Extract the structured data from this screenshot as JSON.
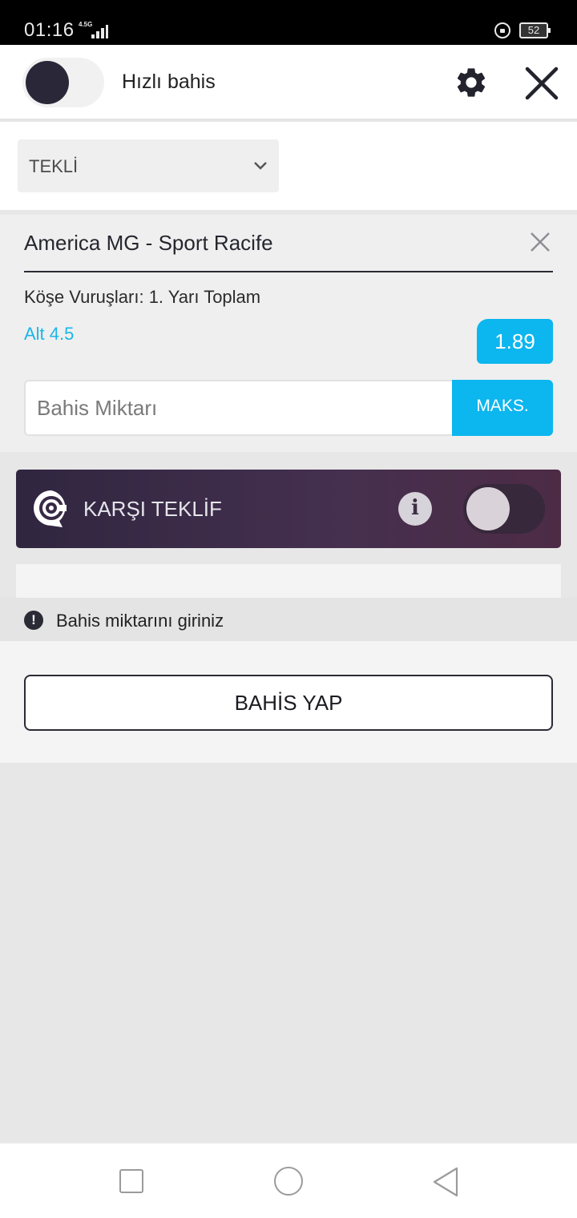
{
  "status_bar": {
    "time": "01:16",
    "network": "4.5G",
    "battery": "52"
  },
  "header": {
    "quick_bet_label": "Hızlı bahis"
  },
  "bet_type": {
    "selected": "TEKLİ"
  },
  "bet": {
    "match": "America MG - Sport Racife",
    "market": "Köşe Vuruşları: 1. Yarı Toplam",
    "selection": "Alt 4.5",
    "odds": "1.89",
    "stake_placeholder": "Bahis Miktarı",
    "max_label": "MAKS."
  },
  "counter_offer": {
    "label": "KARŞI TEKLİF",
    "info_glyph": "i",
    "enabled": false
  },
  "warning": {
    "icon_glyph": "!",
    "text": "Bahis miktarını giriniz"
  },
  "place_bet": {
    "label": "BAHİS YAP"
  },
  "colors": {
    "accent": "#0cb6ee",
    "dark": "#2b2b35",
    "offer_bg": "#3a2b47"
  },
  "icons": [
    "gear-icon",
    "close-icon",
    "chevron-down-icon",
    "remove-icon",
    "counter-offer-logo-icon",
    "info-icon",
    "alert-icon"
  ]
}
